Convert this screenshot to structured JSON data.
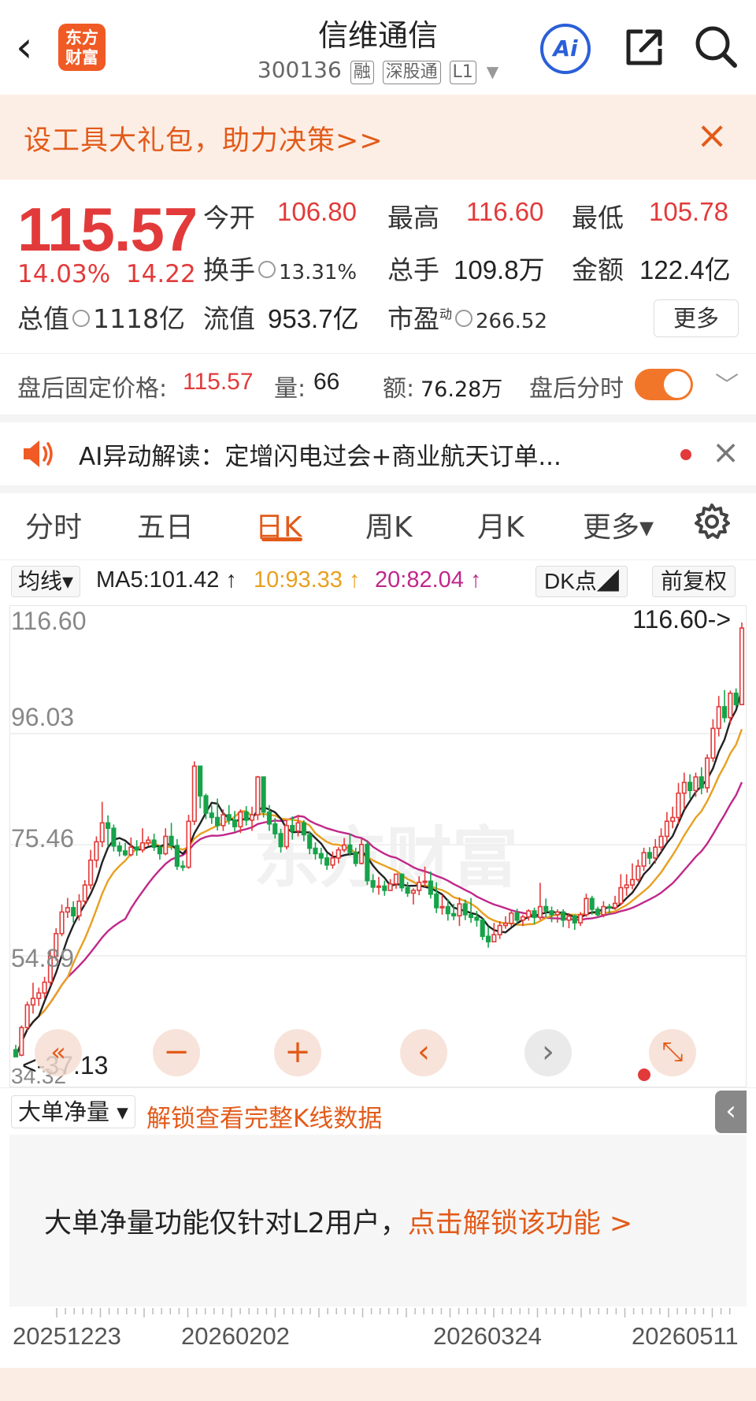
{
  "header": {
    "back_icon": "‹",
    "logo_line1": "东方",
    "logo_line2": "财富",
    "stock_name": "信维通信",
    "stock_code": "300136",
    "tags": [
      "融",
      "深股通",
      "L1"
    ],
    "ai_label": "Ai"
  },
  "banner": {
    "text": "设工具大礼包，助力决策>>",
    "close": "×"
  },
  "quote": {
    "price": "115.57",
    "change_pct": "14.03%",
    "change_amt": "14.22",
    "open_label": "今开",
    "open": "106.80",
    "high_label": "最高",
    "high": "116.60",
    "low_label": "最低",
    "low": "105.78",
    "turnover_label": "换手",
    "turnover": "13.31%",
    "volume_label": "总手",
    "volume": "109.8万",
    "amount_label": "金额",
    "amount": "122.4亿",
    "mktcap_label": "总值",
    "mktcap": "1118亿",
    "float_label": "流值",
    "float": "953.7亿",
    "pe_label": "市盈",
    "pe_sup": "动",
    "pe": "266.52",
    "more_label": "更多"
  },
  "after_hours": {
    "label": "盘后固定价格:",
    "price": "115.57",
    "vol_label": "量:",
    "vol": "66",
    "amt_label": "额:",
    "amt": "76.28万",
    "toggle_label": "盘后分时",
    "toggle_on": true
  },
  "ai_bar": {
    "text": "AI异动解读：定增闪电过会+商业航天订单...",
    "close": "×"
  },
  "tabs": [
    {
      "label": "分时"
    },
    {
      "label": "五日"
    },
    {
      "label": "日K"
    },
    {
      "label": "周K"
    },
    {
      "label": "月K"
    },
    {
      "label": "更多▾"
    }
  ],
  "active_tab": "日K",
  "ma": {
    "select": "均线▾",
    "ma5": "MA5:101.42 ↑",
    "ma10": "10:93.33 ↑",
    "ma20": "20:82.04 ↑",
    "dk": "DK点◢",
    "adjust": "前复权",
    "colors": {
      "ma5": "#222222",
      "ma10": "#e8a020",
      "ma20": "#c0288a"
    }
  },
  "chart_labels": {
    "y1": "116.60",
    "y2": "96.03",
    "y3": "75.46",
    "y4": "54.89",
    "y5": "34.32",
    "high_marker": "116.60->",
    "low_marker": "<-37.13",
    "watermark": "东方财富"
  },
  "controls": {
    "minus": "−",
    "plus": "+",
    "left": "‹",
    "right": "›",
    "expand": "⤡"
  },
  "sub": {
    "select": "大单净量 ▾",
    "link": "解锁查看完整K线数据",
    "collapse": "‹",
    "notice": "大单净量功能仅针对L2用户，",
    "notice_link": "点击解锁该功能 >"
  },
  "dates": [
    "20251223",
    "20260202",
    "20260324",
    "20260511"
  ],
  "colors": {
    "up": "#e23a3a",
    "down": "#17a34a",
    "accent": "#e25b1a"
  },
  "chart_data": {
    "type": "candlestick",
    "ylim": [
      34.32,
      116.6
    ],
    "high": 116.6,
    "low": 37.13,
    "candles": [
      [
        37.5,
        36.2,
        38.4,
        37.13
      ],
      [
        36.5,
        41.6,
        42.0,
        36.3
      ],
      [
        41.6,
        45.8,
        46.4,
        41.1
      ],
      [
        45.8,
        47.0,
        49.9,
        44.2
      ],
      [
        47.0,
        48.0,
        49.0,
        45.6
      ],
      [
        48.0,
        50.0,
        51.0,
        47.0
      ],
      [
        50.0,
        54.8,
        56.0,
        49.3
      ],
      [
        54.8,
        59.0,
        60.0,
        54.0
      ],
      [
        59.0,
        63.0,
        64.4,
        58.5
      ],
      [
        63.0,
        63.8,
        65.6,
        61.9
      ],
      [
        63.8,
        62.3,
        65.0,
        61.0
      ],
      [
        62.3,
        65.0,
        66.3,
        61.4
      ],
      [
        65.0,
        68.0,
        68.9,
        64.2
      ],
      [
        68.0,
        72.6,
        74.5,
        67.2
      ],
      [
        72.6,
        76.0,
        77.0,
        71.2
      ],
      [
        76.0,
        79.5,
        83.4,
        75.0
      ],
      [
        79.5,
        78.5,
        80.9,
        75.0
      ],
      [
        78.5,
        75.2,
        79.2,
        74.2
      ],
      [
        75.2,
        74.3,
        76.0,
        73.3
      ],
      [
        74.3,
        73.6,
        75.8,
        73.3
      ],
      [
        73.6,
        75.0,
        76.8,
        73.3
      ],
      [
        75.0,
        74.5,
        76.3,
        73.4
      ],
      [
        74.5,
        75.8,
        78.5,
        74.0
      ],
      [
        75.8,
        76.3,
        77.0,
        75.2
      ],
      [
        76.3,
        75.0,
        77.5,
        74.3
      ],
      [
        75.0,
        73.8,
        75.4,
        72.7
      ],
      [
        73.8,
        77.0,
        78.5,
        73.5
      ],
      [
        77.0,
        75.3,
        79.5,
        74.5
      ],
      [
        75.3,
        71.5,
        76.5,
        70.8
      ],
      [
        71.5,
        71.3,
        72.5,
        70.6
      ],
      [
        71.3,
        79.8,
        81.0,
        71.0
      ],
      [
        79.8,
        90.0,
        90.9,
        79.1
      ],
      [
        90.0,
        84.5,
        88.9,
        82.2
      ],
      [
        84.5,
        81.3,
        84.9,
        80.2
      ],
      [
        81.3,
        80.5,
        82.7,
        79.3
      ],
      [
        80.5,
        79.0,
        84.0,
        78.1
      ],
      [
        79.0,
        81.0,
        82.0,
        78.0
      ],
      [
        81.0,
        80.0,
        82.8,
        79.2
      ],
      [
        80.0,
        78.8,
        81.7,
        77.9
      ],
      [
        78.8,
        81.5,
        82.0,
        77.6
      ],
      [
        81.5,
        80.0,
        82.6,
        79.0
      ],
      [
        80.0,
        81.0,
        82.5,
        78.0
      ],
      [
        81.0,
        88.0,
        88.2,
        80.0
      ],
      [
        88.0,
        81.5,
        87.5,
        80.5
      ],
      [
        81.5,
        79.3,
        82.8,
        78.0
      ],
      [
        79.3,
        77.5,
        80.4,
        76.6
      ],
      [
        77.5,
        75.1,
        78.4,
        74.0
      ],
      [
        75.1,
        79.0,
        80.0,
        74.6
      ],
      [
        79.0,
        78.0,
        80.7,
        76.4
      ],
      [
        78.0,
        79.5,
        81.0,
        77.0
      ],
      [
        79.5,
        77.3,
        80.0,
        76.1
      ],
      [
        77.3,
        74.8,
        78.0,
        73.7
      ],
      [
        74.8,
        73.8,
        75.9,
        72.7
      ],
      [
        73.8,
        73.0,
        74.9,
        71.8
      ],
      [
        73.0,
        71.7,
        73.9,
        70.8
      ],
      [
        71.7,
        73.0,
        74.2,
        71.0
      ],
      [
        73.0,
        74.5,
        75.0,
        72.0
      ],
      [
        74.5,
        75.4,
        76.7,
        74.1
      ],
      [
        75.4,
        74.0,
        77.5,
        73.4
      ],
      [
        74.0,
        72.0,
        74.9,
        71.4
      ],
      [
        72.0,
        75.5,
        76.7,
        71.8
      ],
      [
        75.5,
        68.8,
        76.3,
        68.0
      ],
      [
        68.8,
        67.6,
        70.0,
        66.6
      ],
      [
        67.6,
        67.8,
        69.5,
        66.2
      ],
      [
        67.8,
        67.0,
        68.8,
        66.0
      ],
      [
        67.0,
        68.2,
        69.1,
        66.9
      ],
      [
        68.2,
        70.0,
        70.0,
        67.3
      ],
      [
        70.0,
        67.5,
        70.1,
        66.8
      ],
      [
        67.5,
        66.5,
        68.6,
        65.8
      ],
      [
        66.5,
        67.0,
        67.4,
        64.4
      ],
      [
        67.0,
        68.5,
        69.6,
        66.1
      ],
      [
        68.5,
        68.7,
        71.4,
        67.6
      ],
      [
        68.7,
        66.3,
        70.5,
        65.5
      ],
      [
        66.3,
        63.8,
        68.5,
        62.8
      ],
      [
        63.8,
        64.0,
        66.2,
        62.5
      ],
      [
        64.0,
        62.7,
        65.4,
        61.4
      ],
      [
        62.7,
        62.3,
        64.5,
        61.5
      ],
      [
        62.3,
        64.5,
        65.7,
        60.4
      ],
      [
        64.5,
        62.5,
        65.3,
        61.5
      ],
      [
        62.5,
        62.0,
        65.6,
        61.0
      ],
      [
        62.0,
        61.5,
        63.2,
        60.3
      ],
      [
        61.5,
        58.5,
        61.8,
        57.8
      ],
      [
        58.5,
        57.5,
        60.3,
        56.4
      ],
      [
        57.5,
        58.8,
        61.0,
        57.5
      ],
      [
        58.8,
        60.5,
        61.3,
        58.0
      ],
      [
        60.5,
        60.9,
        62.2,
        59.9
      ],
      [
        60.9,
        62.8,
        63.5,
        60.3
      ],
      [
        62.8,
        61.5,
        63.6,
        60.8
      ],
      [
        61.5,
        62.1,
        62.5,
        60.4
      ],
      [
        62.1,
        63.2,
        63.5,
        61.4
      ],
      [
        63.2,
        62.0,
        63.8,
        60.8
      ],
      [
        62.0,
        64.0,
        68.4,
        61.5
      ],
      [
        64.0,
        63.2,
        65.5,
        62.0
      ],
      [
        63.2,
        62.5,
        64.0,
        61.1
      ],
      [
        62.5,
        63.0,
        63.5,
        61.0
      ],
      [
        63.0,
        61.5,
        63.5,
        60.2
      ],
      [
        61.5,
        62.2,
        62.8,
        60.0
      ],
      [
        62.2,
        61.0,
        62.5,
        59.7
      ],
      [
        61.0,
        62.5,
        63.0,
        60.4
      ],
      [
        62.5,
        65.5,
        66.4,
        62.1
      ],
      [
        65.5,
        63.5,
        66.0,
        62.5
      ],
      [
        63.5,
        62.5,
        64.0,
        62.0
      ],
      [
        62.5,
        64.0,
        65.0,
        62.0
      ],
      [
        64.0,
        63.8,
        64.5,
        62.5
      ],
      [
        63.8,
        64.6,
        66.0,
        63.4
      ],
      [
        64.6,
        67.5,
        70.0,
        64.2
      ],
      [
        67.5,
        68.0,
        70.0,
        66.0
      ],
      [
        68.0,
        69.0,
        72.0,
        67.2
      ],
      [
        69.0,
        71.5,
        72.7,
        68.6
      ],
      [
        71.5,
        74.0,
        74.9,
        70.6
      ],
      [
        74.0,
        73.0,
        75.0,
        71.8
      ],
      [
        73.0,
        75.0,
        76.5,
        72.0
      ],
      [
        75.0,
        77.0,
        78.5,
        74.2
      ],
      [
        77.0,
        79.8,
        81.5,
        76.0
      ],
      [
        79.8,
        80.5,
        82.5,
        78.5
      ],
      [
        80.5,
        85.0,
        86.9,
        79.3
      ],
      [
        85.0,
        87.0,
        88.8,
        82.0
      ],
      [
        87.0,
        85.5,
        88.5,
        84.0
      ],
      [
        85.5,
        88.0,
        88.8,
        84.3
      ],
      [
        88.0,
        86.0,
        89.8,
        84.8
      ],
      [
        86.0,
        91.5,
        92.2,
        85.1
      ],
      [
        91.5,
        97.0,
        98.7,
        90.8
      ],
      [
        97.0,
        101.0,
        103.0,
        95.5
      ],
      [
        101.0,
        99.0,
        104.1,
        98.1
      ],
      [
        99.0,
        103.5,
        104.0,
        97.8
      ],
      [
        103.5,
        101.4,
        104.4,
        101.0
      ],
      [
        101.4,
        115.57,
        116.6,
        105.78
      ]
    ],
    "ma_series": [
      {
        "name": "MA5",
        "value": 101.42
      },
      {
        "name": "MA10",
        "value": 93.33
      },
      {
        "name": "MA20",
        "value": 82.04
      }
    ]
  }
}
